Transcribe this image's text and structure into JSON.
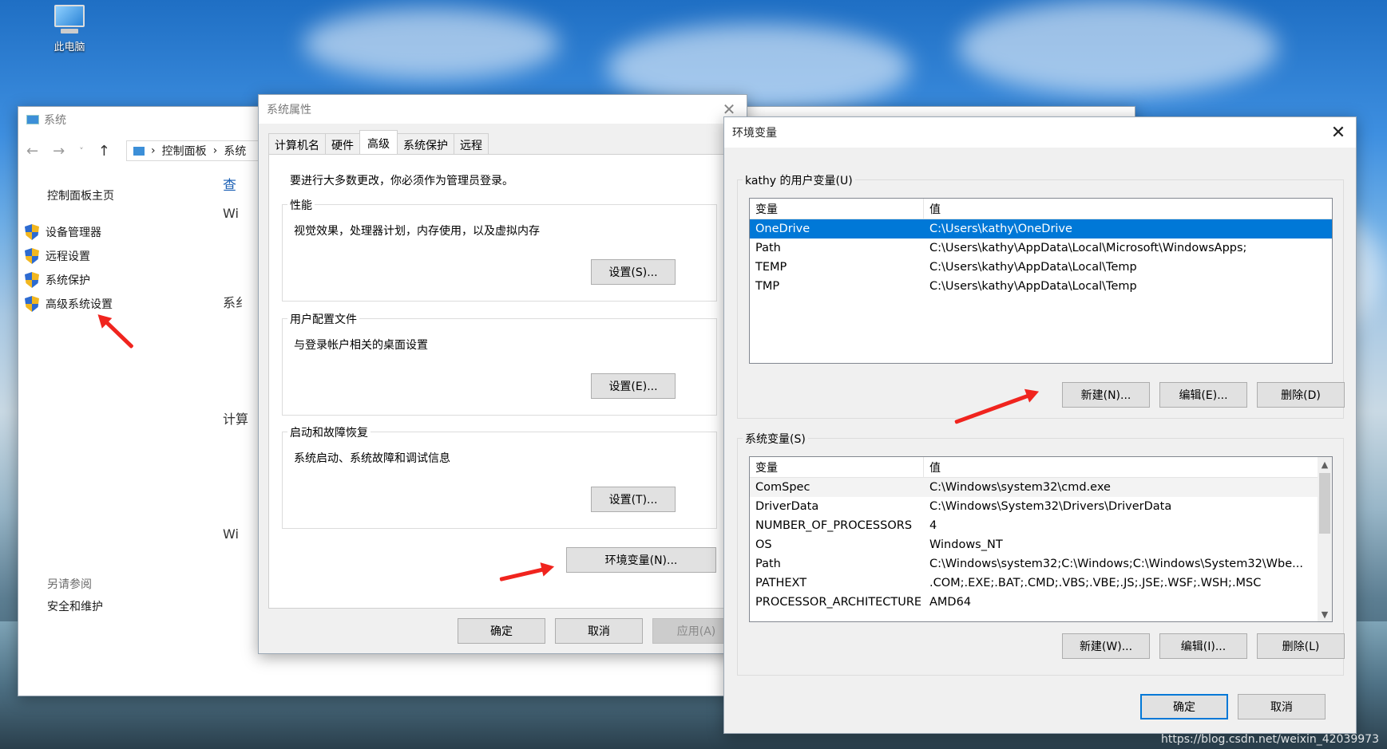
{
  "desktop": {
    "icon_label": "此电脑"
  },
  "control_panel": {
    "title": "系统",
    "breadcrumb": [
      "控制面板",
      "系统"
    ],
    "home_link": "控制面板主页",
    "links": [
      "设备管理器",
      "远程设置",
      "系统保护",
      "高级系统设置"
    ],
    "see_also": "另请参阅",
    "safety_link": "安全和维护",
    "fragments": [
      "查",
      "Wi",
      "系纟",
      "计算",
      "Wi"
    ]
  },
  "system_properties": {
    "title": "系统属性",
    "tabs": [
      "计算机名",
      "硬件",
      "高级",
      "系统保护",
      "远程"
    ],
    "active_tab": "高级",
    "admin_note": "要进行大多数更改，你必须作为管理员登录。",
    "groups": [
      {
        "title": "性能",
        "desc": "视觉效果，处理器计划，内存使用，以及虚拟内存",
        "button": "设置(S)..."
      },
      {
        "title": "用户配置文件",
        "desc": "与登录帐户相关的桌面设置",
        "button": "设置(E)..."
      },
      {
        "title": "启动和故障恢复",
        "desc": "系统启动、系统故障和调试信息",
        "button": "设置(T)..."
      }
    ],
    "env_button": "环境变量(N)...",
    "ok": "确定",
    "cancel": "取消",
    "apply": "应用(A)"
  },
  "env_vars": {
    "title": "环境变量",
    "user_group_title": "kathy 的用户变量(U)",
    "col_var": "变量",
    "col_val": "值",
    "user_rows": [
      {
        "name": "OneDrive",
        "value": "C:\\Users\\kathy\\OneDrive"
      },
      {
        "name": "Path",
        "value": "C:\\Users\\kathy\\AppData\\Local\\Microsoft\\WindowsApps;"
      },
      {
        "name": "TEMP",
        "value": "C:\\Users\\kathy\\AppData\\Local\\Temp"
      },
      {
        "name": "TMP",
        "value": "C:\\Users\\kathy\\AppData\\Local\\Temp"
      }
    ],
    "user_buttons": {
      "new": "新建(N)...",
      "edit": "编辑(E)...",
      "delete": "删除(D)"
    },
    "system_group_title": "系统变量(S)",
    "system_rows": [
      {
        "name": "ComSpec",
        "value": "C:\\Windows\\system32\\cmd.exe"
      },
      {
        "name": "DriverData",
        "value": "C:\\Windows\\System32\\Drivers\\DriverData"
      },
      {
        "name": "NUMBER_OF_PROCESSORS",
        "value": "4"
      },
      {
        "name": "OS",
        "value": "Windows_NT"
      },
      {
        "name": "Path",
        "value": "C:\\Windows\\system32;C:\\Windows;C:\\Windows\\System32\\Wbe..."
      },
      {
        "name": "PATHEXT",
        "value": ".COM;.EXE;.BAT;.CMD;.VBS;.VBE;.JS;.JSE;.WSF;.WSH;.MSC"
      },
      {
        "name": "PROCESSOR_ARCHITECTURE",
        "value": "AMD64"
      }
    ],
    "system_buttons": {
      "new": "新建(W)...",
      "edit": "编辑(I)...",
      "delete": "删除(L)"
    },
    "ok": "确定",
    "cancel": "取消"
  },
  "watermark": "https://blog.csdn.net/weixin_42039973",
  "colors": {
    "selection": "#0078d7",
    "arrow": "#f0241e"
  }
}
